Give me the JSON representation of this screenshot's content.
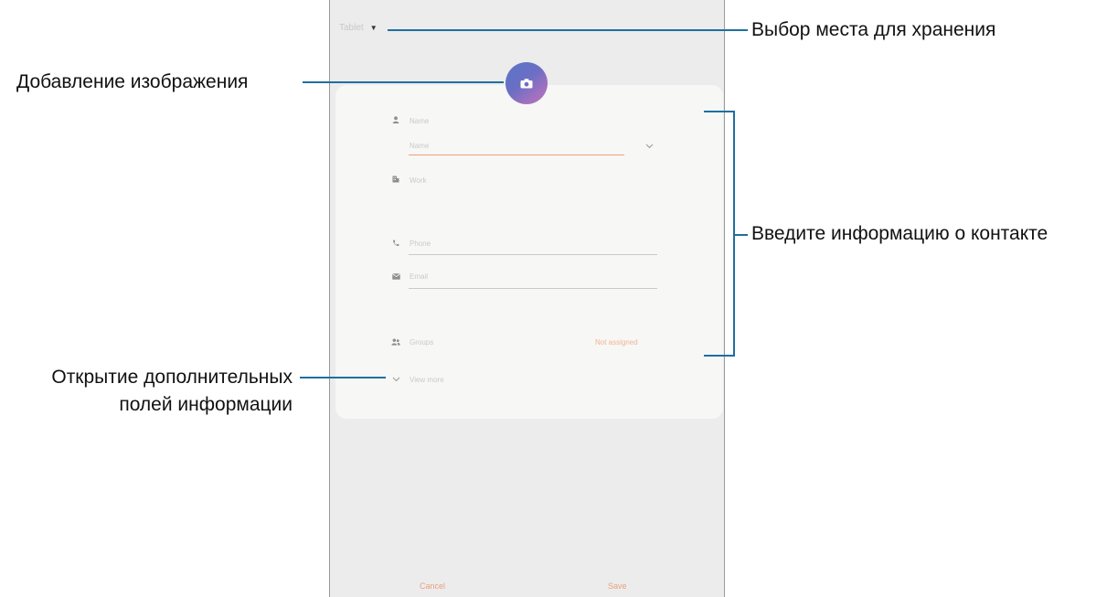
{
  "screen": {
    "storage_selector": "Tablet",
    "name_section_label": "Name",
    "name_field_placeholder": "Name",
    "organization_label": "Work",
    "phone_placeholder": "Phone",
    "email_placeholder": "Email",
    "groups_label": "Groups",
    "groups_value": "Not assigned",
    "view_more_label": "View more",
    "cancel_button": "Cancel",
    "save_button": "Save"
  },
  "annotations": {
    "storage_location": "Выбор места для хранения",
    "add_image": "Добавление изображения",
    "enter_contact_info": "Введите информацию о контакте",
    "open_more_fields_line1": "Открытие дополнительных",
    "open_more_fields_line2": "полей информации"
  },
  "colors": {
    "leader_line": "#1f6fa0",
    "accent": "#f0a07a",
    "avatar_gradient_start": "#5b74c9",
    "avatar_gradient_end": "#b674b6"
  },
  "icons": [
    "caret-down-icon",
    "camera-icon",
    "person-icon",
    "building-icon",
    "phone-icon",
    "email-icon",
    "group-icon",
    "chevron-down-icon"
  ]
}
